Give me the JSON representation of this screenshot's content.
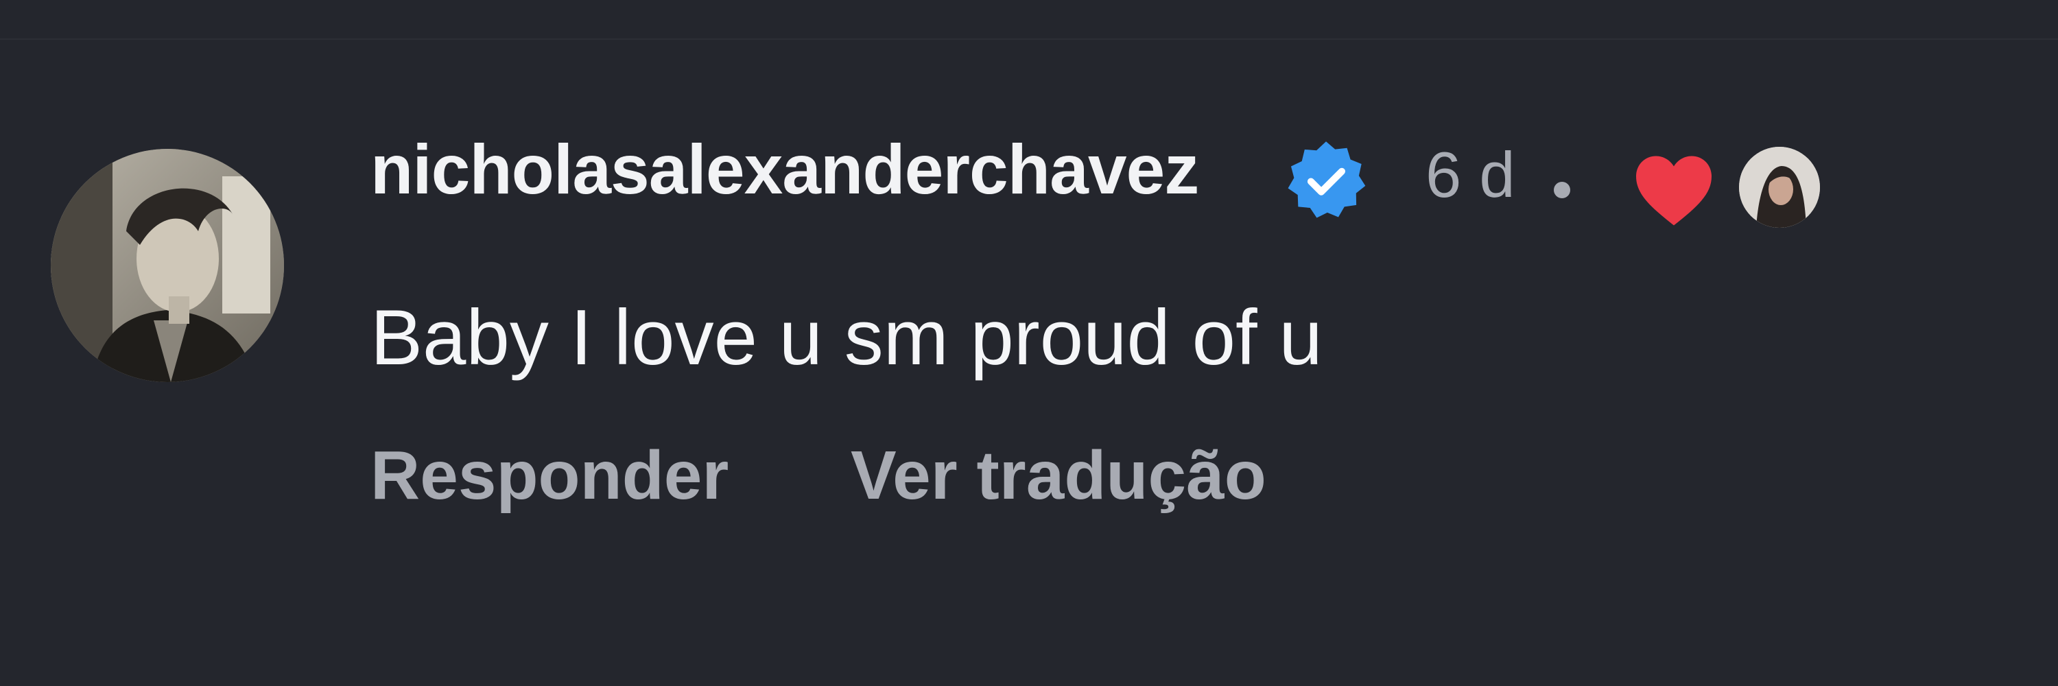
{
  "comment": {
    "username": "nicholasalexanderchavez",
    "verified_icon": "verified-badge-icon",
    "timestamp": "6 d",
    "separator": "•",
    "liked_by_author_icon": "heart-icon",
    "text": "Baby I love u sm proud of u"
  },
  "actions": {
    "reply_label": "Responder",
    "translate_label": "Ver tradução"
  },
  "colors": {
    "background": "#24262d",
    "primary_text": "#f2f3f5",
    "secondary_text": "#a8abb3",
    "verified_blue": "#3897f0",
    "heart_red": "#ed3a48"
  }
}
